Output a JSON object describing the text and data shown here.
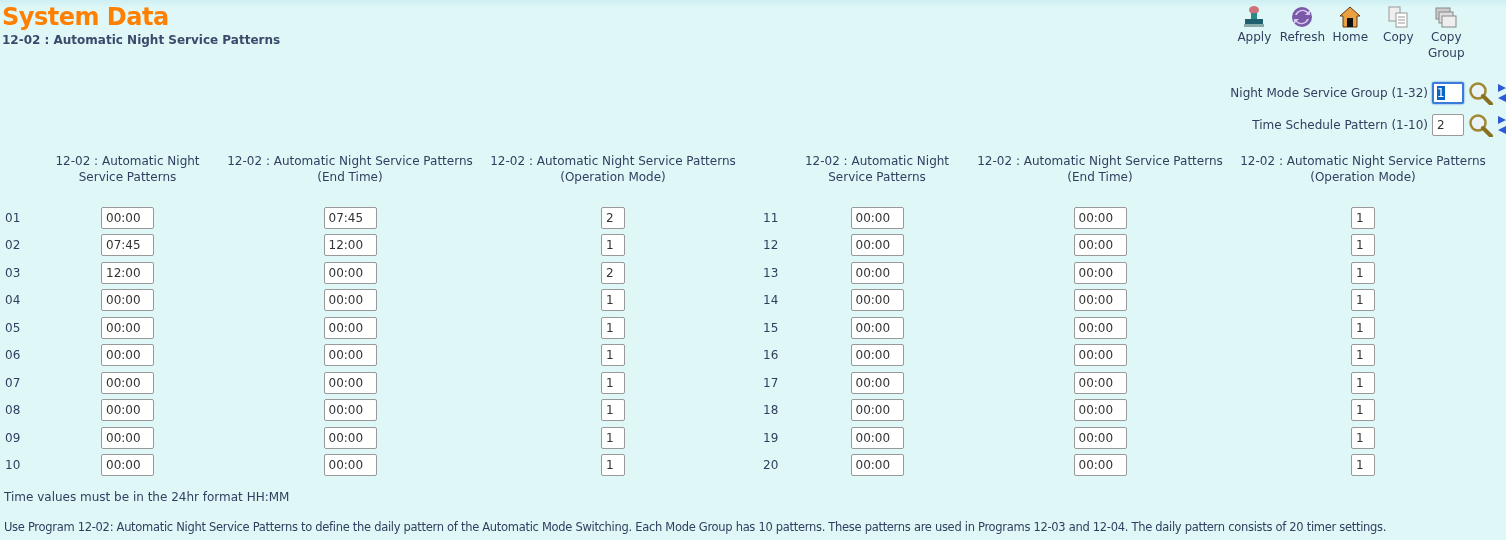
{
  "header": {
    "title": "System Data",
    "subtitle": "12-02 : Automatic Night Service Patterns"
  },
  "toolbar": [
    {
      "kind": "apply",
      "label": "Apply"
    },
    {
      "kind": "refresh",
      "label": "Refresh"
    },
    {
      "kind": "home",
      "label": "Home"
    },
    {
      "kind": "copy",
      "label": "Copy"
    },
    {
      "kind": "copy_group",
      "label": "Copy Group"
    }
  ],
  "selectors": [
    {
      "label": "Night Mode Service Group (1-32)",
      "value": "1",
      "focused": true
    },
    {
      "label": "Time Schedule Pattern (1-10)",
      "value": "2",
      "focused": false
    }
  ],
  "columns": [
    "12-02 : Automatic Night Service Patterns",
    "12-02 : Automatic Night Service Patterns (End Time)",
    "12-02 : Automatic Night Service Patterns (Operation Mode)",
    "12-02 : Automatic Night Service Patterns",
    "12-02 : Automatic Night Service Patterns (End Time)",
    "12-02 : Automatic Night Service Patterns (Operation Mode)"
  ],
  "rows": [
    {
      "number": "01",
      "start": "00:00",
      "end": "07:45",
      "mode": "2"
    },
    {
      "number": "02",
      "start": "07:45",
      "end": "12:00",
      "mode": "1"
    },
    {
      "number": "03",
      "start": "12:00",
      "end": "00:00",
      "mode": "2"
    },
    {
      "number": "04",
      "start": "00:00",
      "end": "00:00",
      "mode": "1"
    },
    {
      "number": "05",
      "start": "00:00",
      "end": "00:00",
      "mode": "1"
    },
    {
      "number": "06",
      "start": "00:00",
      "end": "00:00",
      "mode": "1"
    },
    {
      "number": "07",
      "start": "00:00",
      "end": "00:00",
      "mode": "1"
    },
    {
      "number": "08",
      "start": "00:00",
      "end": "00:00",
      "mode": "1"
    },
    {
      "number": "09",
      "start": "00:00",
      "end": "00:00",
      "mode": "1"
    },
    {
      "number": "10",
      "start": "00:00",
      "end": "00:00",
      "mode": "1"
    },
    {
      "number": "11",
      "start": "00:00",
      "end": "00:00",
      "mode": "1"
    },
    {
      "number": "12",
      "start": "00:00",
      "end": "00:00",
      "mode": "1"
    },
    {
      "number": "13",
      "start": "00:00",
      "end": "00:00",
      "mode": "1"
    },
    {
      "number": "14",
      "start": "00:00",
      "end": "00:00",
      "mode": "1"
    },
    {
      "number": "15",
      "start": "00:00",
      "end": "00:00",
      "mode": "1"
    },
    {
      "number": "16",
      "start": "00:00",
      "end": "00:00",
      "mode": "1"
    },
    {
      "number": "17",
      "start": "00:00",
      "end": "00:00",
      "mode": "1"
    },
    {
      "number": "18",
      "start": "00:00",
      "end": "00:00",
      "mode": "1"
    },
    {
      "number": "19",
      "start": "00:00",
      "end": "00:00",
      "mode": "1"
    },
    {
      "number": "20",
      "start": "00:00",
      "end": "00:00",
      "mode": "1"
    }
  ],
  "notes": [
    "Time values must be in the 24hr format HH:MM",
    "Use Program 12-02: Automatic Night Service Patterns to define the daily pattern of the Automatic Mode Switching. Each Mode Group has 10 patterns. These patterns are used in Programs 12-03 and 12-04. The daily pattern consists of 20 timer settings."
  ]
}
